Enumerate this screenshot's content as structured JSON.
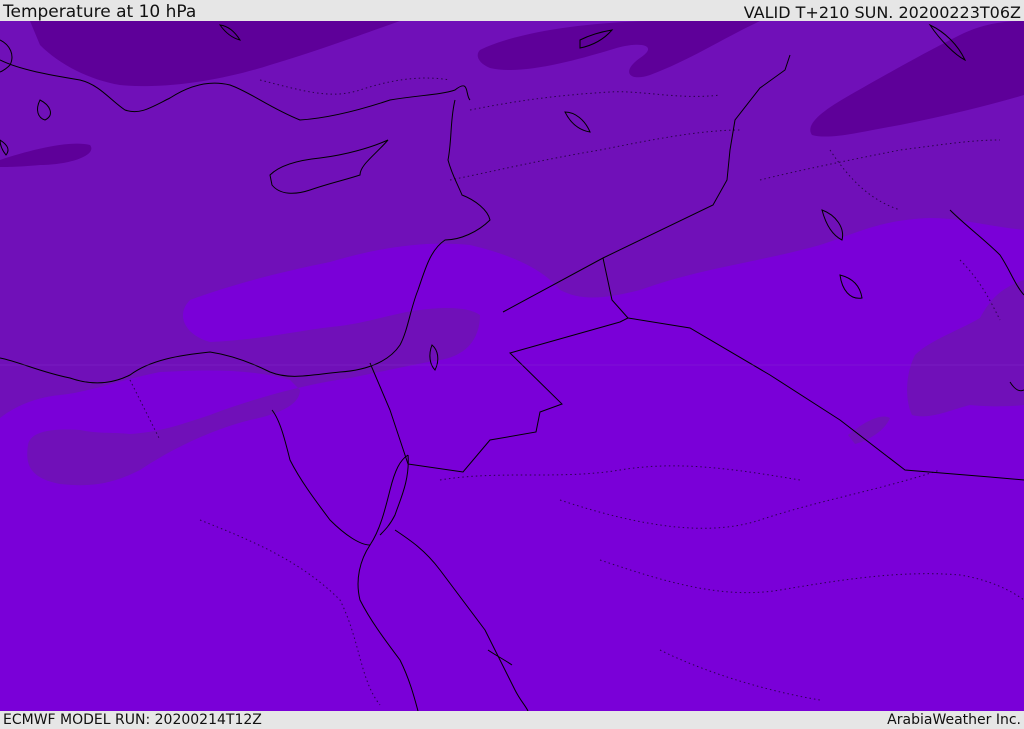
{
  "header": {
    "title": "Temperature at 10 hPa",
    "valid": "VALID T+210 SUN. 20200223T06Z"
  },
  "footer": {
    "model_run": "ECMWF MODEL RUN: 20200214T12Z",
    "credit": "ArabiaWeather Inc."
  },
  "colors": {
    "band_cold": "#5e0099",
    "band_mid": "#7010b8",
    "band_warm": "#7a00d8",
    "coast": "#000000",
    "bar_bg": "#e6e6e6"
  }
}
